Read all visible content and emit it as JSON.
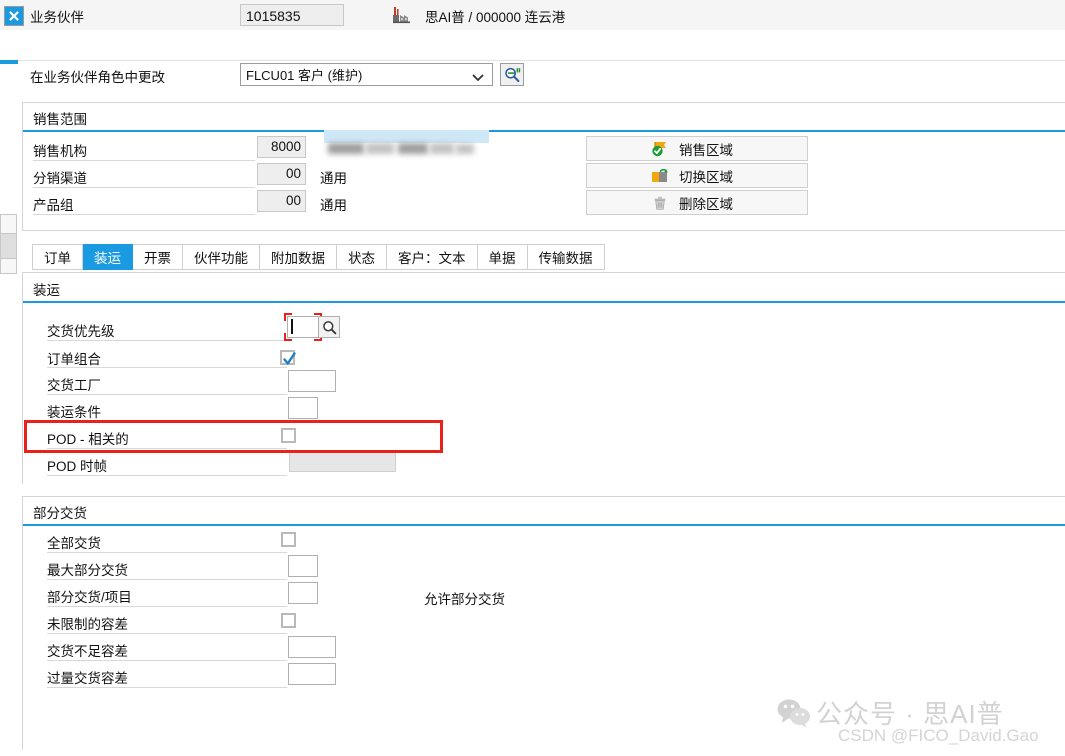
{
  "header": {
    "close_icon": "close-icon",
    "bp_label": "业务伙伴",
    "bp_value": "1015835",
    "factory_icon": "factory-icon",
    "bp_description": "思AI普 / 000000 连云港",
    "role_label": "在业务伙伴角色中更改",
    "role_value": "FLCU01 客户 (维护)",
    "role_chevron_icon": "chevron-down-icon",
    "role_search_icon": "search-list-icon"
  },
  "sales_area": {
    "title": "销售范围",
    "rows": [
      {
        "label": "销售机构",
        "value": "8000",
        "text": ""
      },
      {
        "label": "分销渠道",
        "value": "00",
        "text": "通用"
      },
      {
        "label": "产品组",
        "value": "00",
        "text": "通用"
      }
    ],
    "buttons": [
      {
        "label": "销售区域",
        "icon": "sales-area-check-icon"
      },
      {
        "label": "切换区域",
        "icon": "switch-area-icon"
      },
      {
        "label": "删除区域",
        "icon": "trash-icon"
      }
    ]
  },
  "tabs": [
    {
      "label": "订单",
      "active": false
    },
    {
      "label": "装运",
      "active": true
    },
    {
      "label": "开票",
      "active": false
    },
    {
      "label": "伙伴功能",
      "active": false
    },
    {
      "label": "附加数据",
      "active": false
    },
    {
      "label": "状态",
      "active": false
    },
    {
      "label": "客户：文本",
      "active": false
    },
    {
      "label": "单据",
      "active": false
    },
    {
      "label": "传输数据",
      "active": false
    }
  ],
  "shipping": {
    "title": "装运",
    "delivery_priority": {
      "label": "交货优先级",
      "value": "",
      "search_icon": "magnifier-icon"
    },
    "order_combination": {
      "label": "订单组合",
      "checked": true
    },
    "delivery_plant": {
      "label": "交货工厂",
      "value": ""
    },
    "shipping_conditions": {
      "label": "装运条件",
      "value": ""
    },
    "pod_relevant": {
      "label": "POD - 相关的",
      "checked": false
    },
    "pod_timeframe": {
      "label": "POD 时帧",
      "value": "",
      "disabled": true
    }
  },
  "partial_delivery": {
    "title": "部分交货",
    "complete_delivery": {
      "label": "全部交货",
      "checked": false
    },
    "max_partial_deliveries": {
      "label": "最大部分交货",
      "value": ""
    },
    "partial_delivery_item": {
      "label": "部分交货/项目",
      "value": "",
      "note": "允许部分交货"
    },
    "unlimited_tolerance": {
      "label": "未限制的容差",
      "checked": false
    },
    "underdelivery_tolerance": {
      "label": "交货不足容差",
      "value": ""
    },
    "overdelivery_tolerance": {
      "label": "过量交货容差",
      "value": ""
    }
  },
  "watermark": {
    "icon": "wechat-icon",
    "line1": "公众号 · 思AI普",
    "line2": "CSDN @FICO_David.Gao"
  },
  "colors": {
    "accent_blue": "#1a9ae0",
    "annotation_red": "#e8211a",
    "highlight_blue": "#cfe8f7"
  }
}
